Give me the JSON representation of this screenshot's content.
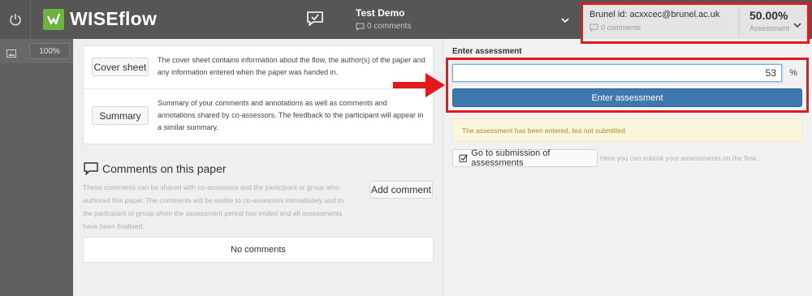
{
  "app": {
    "brand": "WISEflow"
  },
  "flow": {
    "title": "Test Demo",
    "comments": "0 comments"
  },
  "assessor": {
    "id_text": "Brunel id: acxxcec@brunel.ac.uk",
    "comments": "0 comments",
    "percentage": "50.00%",
    "percentage_label": "Assessment"
  },
  "toolbar": {
    "zoom": "100%"
  },
  "cover_sheet": {
    "button_label": "Cover sheet",
    "description": "The cover sheet contains information about the flow, the author(s) of the paper and any information entered when the paper was handed in."
  },
  "summary": {
    "button_label": "Summary",
    "description": "Summary of your comments and annotations as well as comments and annotations shared by co-assessors. The feedback to the participant will appear in a similar summary."
  },
  "comments_section": {
    "title": "Comments on this paper",
    "description": "These comments can be shared with co-assessors and the participant or group who authored this paper. The comments will be visible to co-assessors immediately and to the participant or group when the assessment period has ended and all assessments have been finalised.",
    "add_button": "Add comment",
    "empty_text": "No comments"
  },
  "assessment": {
    "label": "Enter assessment",
    "value": "53",
    "unit": "%",
    "button_label": "Enter assessment",
    "warning": "The assessment has been entered, but not submitted",
    "goto_button": "Go to submission of assessments",
    "goto_hint": "Here you can submit your assessments on the flow."
  },
  "colors": {
    "brand_green": "#6cb33f",
    "primary_button": "#3e78ae",
    "annotation_red": "#e3191b",
    "warning_text": "#a48b2c"
  }
}
